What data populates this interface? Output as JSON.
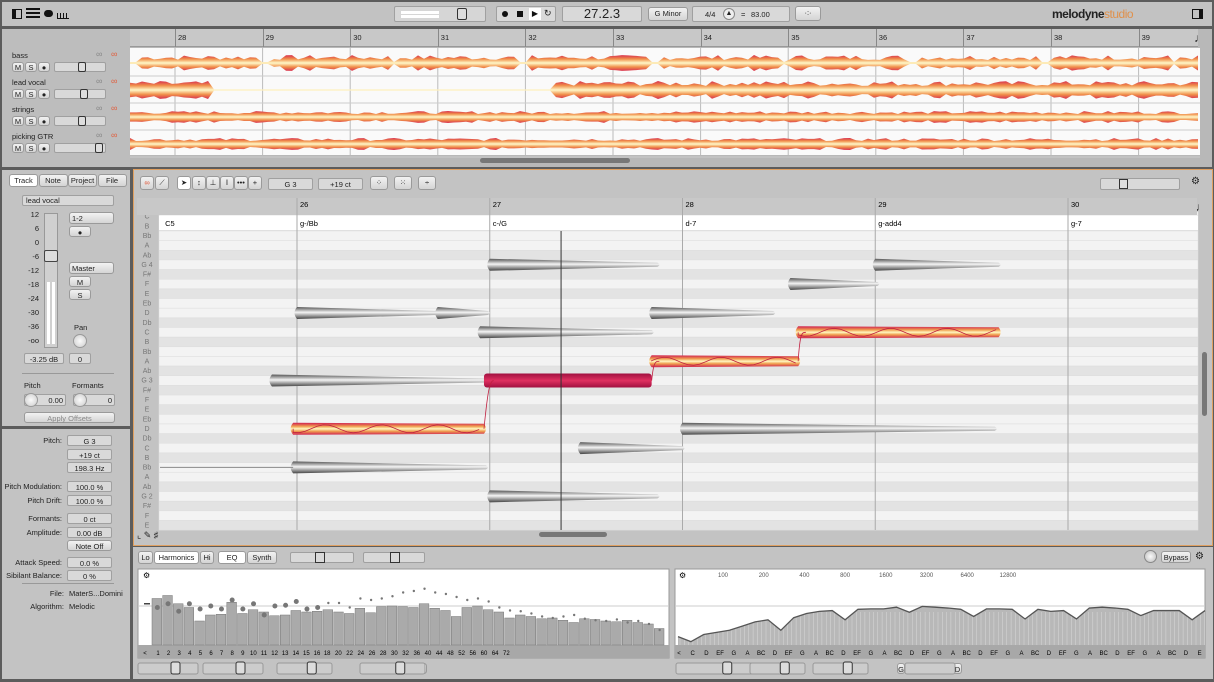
{
  "toolbar": {
    "position": "27.2.3",
    "key": "G Minor",
    "meter": "4/4",
    "tempo_eq": "=",
    "tempo": "83.00",
    "logo_main": "melodyne",
    "logo_sub": "studio"
  },
  "arrange": {
    "bars": [
      "28",
      "29",
      "30",
      "31",
      "32",
      "33",
      "34",
      "35",
      "36",
      "37",
      "38",
      "39"
    ],
    "tracks": [
      {
        "name": "bass",
        "m": "M",
        "s": "S",
        "fader": 0.55
      },
      {
        "name": "lead vocal",
        "m": "M",
        "s": "S",
        "fader": 0.6
      },
      {
        "name": "strings",
        "m": "M",
        "s": "S",
        "fader": 0.55
      },
      {
        "name": "picking GTR",
        "m": "M",
        "s": "S",
        "fader": 0.95
      }
    ]
  },
  "inspector": {
    "tabs": [
      "Track",
      "Note",
      "Project",
      "File"
    ],
    "active_tab": "Track",
    "track_name": "lead vocal",
    "scale": [
      "12",
      "6",
      "0",
      "-6",
      "-12",
      "-18",
      "-24",
      "-30",
      "-36",
      "-oo"
    ],
    "output": "1-2",
    "send": "Master",
    "mute": "M",
    "solo": "S",
    "pan_label": "Pan",
    "volume": "-3.25 dB",
    "pan": "0",
    "pitch_label": "Pitch",
    "pitch": "0.00",
    "formants_label": "Formants",
    "formants": "0",
    "apply": "Apply Offsets"
  },
  "note_inspector": [
    {
      "label": "Pitch:",
      "value": "G 3"
    },
    {
      "label": "",
      "value": "+19 ct"
    },
    {
      "label": "",
      "value": "198.3 Hz"
    },
    {
      "label": "Pitch Modulation:",
      "value": "100.0 %"
    },
    {
      "label": "Pitch Drift:",
      "value": "100.0 %"
    },
    {
      "label": "Formants:",
      "value": "0 ct"
    },
    {
      "label": "Amplitude:",
      "value": "0.00 dB"
    },
    {
      "label": "",
      "value": "Note Off"
    },
    {
      "label": "Attack Speed:",
      "value": "0.0 %"
    },
    {
      "label": "Sibilant Balance:",
      "value": "0 %"
    }
  ],
  "file_info": {
    "file_label": "File:",
    "file": "MaterS...Domini",
    "algo_label": "Algorithm:",
    "algo": "Melodic"
  },
  "editor": {
    "pitch_name": "G 3",
    "cents": "+19 ct",
    "bars": [
      "26",
      "27",
      "28",
      "29",
      "30"
    ],
    "chords": [
      {
        "bar": 25.3,
        "name": "C5"
      },
      {
        "bar": 26,
        "name": "g-/Bb"
      },
      {
        "bar": 27,
        "name": "c-/G"
      },
      {
        "bar": 28,
        "name": "d-7"
      },
      {
        "bar": 29,
        "name": "g-add4"
      },
      {
        "bar": 30,
        "name": "g-7"
      }
    ],
    "pitch_rows": [
      "C",
      "B",
      "Bb",
      "A",
      "Ab",
      "G 4",
      "F#",
      "F",
      "E",
      "Eb",
      "D",
      "Db",
      "C",
      "B",
      "Bb",
      "A",
      "Ab",
      "G 3",
      "F#",
      "F",
      "E",
      "Eb",
      "D",
      "Db",
      "C",
      "B",
      "Bb",
      "A",
      "Ab",
      "G 2",
      "F#",
      "F",
      "E"
    ],
    "playhead_bar": 27.37,
    "notes": [
      {
        "pitch": "D4",
        "row": 10,
        "start": 26.0,
        "end": 26.72,
        "type": "gray"
      },
      {
        "pitch": "D4",
        "row": 10,
        "start": 26.73,
        "end": 26.99,
        "type": "gray"
      },
      {
        "pitch": "G3",
        "row": 17,
        "start": 25.87,
        "end": 26.98,
        "type": "gray"
      },
      {
        "pitch": "D3",
        "row": 22,
        "start": 25.98,
        "end": 26.97,
        "type": "colored"
      },
      {
        "pitch": "Bb2",
        "row": 26,
        "start": 25.98,
        "end": 26.98,
        "type": "gray"
      },
      {
        "pitch": "G4",
        "row": 5,
        "start": 27.0,
        "end": 27.87,
        "type": "gray"
      },
      {
        "pitch": "C4",
        "row": 12,
        "start": 26.95,
        "end": 27.84,
        "type": "gray"
      },
      {
        "pitch": "G3",
        "row": 17,
        "start": 26.97,
        "end": 27.84,
        "type": "selected"
      },
      {
        "pitch": "C3",
        "row": 24,
        "start": 27.47,
        "end": 28.0,
        "type": "gray"
      },
      {
        "pitch": "G2",
        "row": 29,
        "start": 27.0,
        "end": 27.87,
        "type": "gray"
      },
      {
        "pitch": "A3",
        "row": 15,
        "start": 27.84,
        "end": 28.6,
        "type": "colored"
      },
      {
        "pitch": "D4",
        "row": 10,
        "start": 27.84,
        "end": 28.47,
        "type": "gray"
      },
      {
        "pitch": "D3",
        "row": 22,
        "start": 28.0,
        "end": 29.62,
        "type": "gray"
      },
      {
        "pitch": "F#4",
        "row": 7,
        "start": 28.56,
        "end": 29.01,
        "type": "gray"
      },
      {
        "pitch": "C4",
        "row": 12,
        "start": 28.6,
        "end": 29.64,
        "type": "colored"
      },
      {
        "pitch": "G4",
        "row": 5,
        "start": 29.0,
        "end": 29.64,
        "type": "gray"
      }
    ]
  },
  "sound_editor": {
    "tabs": [
      "Lo",
      "Harmonics",
      "Hi",
      "EQ",
      "Synth"
    ],
    "bypass": "Bypass",
    "harmonic_labels": [
      "<",
      "1",
      "2",
      "3",
      "4",
      "5",
      "6",
      "7",
      "8",
      "9",
      "10",
      "11",
      "12",
      "13",
      "14",
      "15",
      "16",
      "18",
      "20",
      "22",
      "24",
      "26",
      "28",
      "30",
      "32",
      "36",
      "40",
      "44",
      "48",
      "52",
      "56",
      "60",
      "64",
      "72"
    ],
    "harmonic_levels": [
      0.62,
      0.66,
      0.55,
      0.5,
      0.32,
      0.4,
      0.41,
      0.57,
      0.42,
      0.47,
      0.44,
      0.39,
      0.4,
      0.46,
      0.44,
      0.45,
      0.47,
      0.44,
      0.42,
      0.49,
      0.43,
      0.51,
      0.52,
      0.51,
      0.5,
      0.55,
      0.49,
      0.46,
      0.38,
      0.5,
      0.52,
      0.47,
      0.44,
      0.36,
      0.4,
      0.38,
      0.35,
      0.36,
      0.33,
      0.3,
      0.35,
      0.34,
      0.32,
      0.31,
      0.33,
      0.3,
      0.28,
      0.22
    ],
    "harmonic_dots": [
      0.5,
      0.55,
      0.45,
      0.55,
      0.48,
      0.52,
      0.48,
      0.6,
      0.48,
      0.55,
      0.4,
      0.52,
      0.53,
      0.58,
      0.48,
      0.5,
      0.56,
      0.56,
      0.5,
      0.62,
      0.6,
      0.62,
      0.65,
      0.7,
      0.72,
      0.75,
      0.7,
      0.68,
      0.64,
      0.6,
      0.62,
      0.58,
      0.5,
      0.46,
      0.45,
      0.42,
      0.38,
      0.36,
      0.38,
      0.4,
      0.35,
      0.33,
      0.32,
      0.34,
      0.3,
      0.32,
      0.28,
      0.2
    ],
    "eq_freqs": [
      "100",
      "200",
      "400",
      "800",
      "1600",
      "3200",
      "6400",
      "12800"
    ],
    "eq_notes": [
      "<",
      "C",
      "D",
      "EF",
      "G",
      "A",
      "BC",
      "D",
      "EF",
      "G",
      "A",
      "BC",
      "D",
      "EF",
      "G",
      "A",
      "BC",
      "D",
      "EF",
      "G",
      "A",
      "BC",
      "D",
      "EF",
      "G",
      "A",
      "BC",
      "D",
      "EF",
      "G",
      "A",
      "BC",
      "D",
      "EF",
      "G",
      "A",
      "BC",
      "D",
      "E"
    ],
    "eq_curve": [
      0.2,
      0.08,
      0.25,
      0.3,
      0.35,
      0.45,
      0.55,
      0.6,
      0.35,
      0.65,
      0.75,
      0.8,
      0.82,
      0.6,
      0.85,
      0.86,
      0.86,
      0.9,
      0.78,
      0.92,
      0.9,
      0.88,
      0.85,
      0.68,
      0.86,
      0.86,
      0.85,
      0.62,
      0.85,
      0.8,
      0.82,
      0.62,
      0.88,
      0.9,
      0.88,
      0.85,
      0.7,
      0.82,
      0.82,
      0.82,
      0.6,
      0.82
    ],
    "bottom_left": "1",
    "bottom_right": "3",
    "eq_left": "G",
    "eq_right": "D"
  }
}
